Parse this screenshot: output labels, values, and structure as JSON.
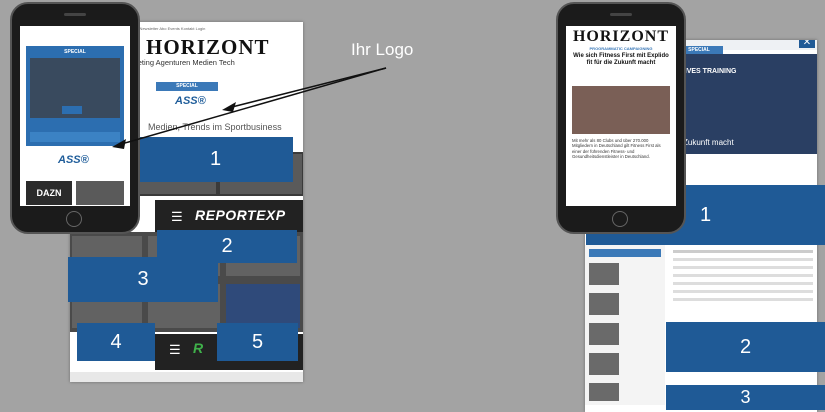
{
  "callout": {
    "text": "Ihr Logo"
  },
  "left_page": {
    "topnav": "Jobs  Newsletter  Abo  Events  Kontakt  Login",
    "logo": "HORIZONT",
    "subnav": "keting  Agenturen  Medien  Tech",
    "special": "SPECIAL",
    "sponsor": "ASS®",
    "headline": "Medien, Trends im Sportbusiness",
    "report_label": "REPORTEXP",
    "report_label_2": "R"
  },
  "phone_left": {
    "special": "SPECIAL",
    "sponsor": "ASS®",
    "dazn": "DAZN"
  },
  "phone_right": {
    "logo": "HORIZONT",
    "kicker": "PROGRAMMATIC CAMPAIGNING",
    "title": "Wie sich Fitness First mit Explido fit für die Zukunft macht",
    "body": "Mit mehr als 80 Clubs und über 270.000 Mitgliedern in Deutschland gilt Fitness First als einer der führenden Fitness- und Gesundheitsdienstleister in Deutschland."
  },
  "right_page": {
    "special": "SPECIAL",
    "banner": "MEHR EFFEKTIVES TRAINING",
    "caption": "First mit Explido fit für die Zukunft macht"
  },
  "overlays": {
    "left": [
      "1",
      "2",
      "3",
      "4",
      "5"
    ],
    "right": [
      "1",
      "2",
      "3"
    ]
  }
}
